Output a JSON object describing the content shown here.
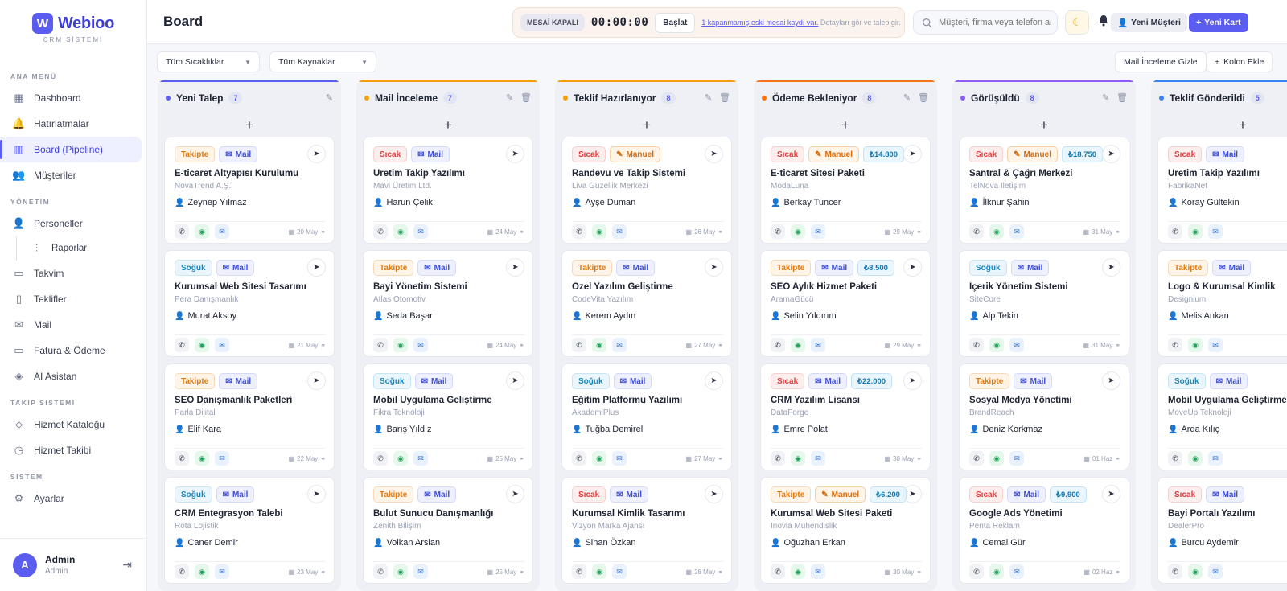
{
  "brand": {
    "name": "Webioo",
    "logo_letter": "W",
    "subtitle": "CRM SİSTEMİ"
  },
  "sidebar": {
    "sections": [
      {
        "title": "ANA MENÜ",
        "items": [
          {
            "label": "Dashboard",
            "icon": "grid-icon"
          },
          {
            "label": "Hatırlatmalar",
            "icon": "bell-icon"
          },
          {
            "label": "Board (Pipeline)",
            "icon": "board-icon",
            "active": true
          },
          {
            "label": "Müşteriler",
            "icon": "users-icon"
          }
        ]
      },
      {
        "title": "YÖNETİM",
        "items": [
          {
            "label": "Personeller",
            "icon": "people-icon"
          },
          {
            "label": "Raporlar",
            "icon": "chart-icon",
            "sub": true
          },
          {
            "label": "Takvim",
            "icon": "calendar-icon"
          },
          {
            "label": "Teklifler",
            "icon": "document-icon"
          },
          {
            "label": "Mail",
            "icon": "mail-icon"
          },
          {
            "label": "Fatura & Ödeme",
            "icon": "card-icon"
          },
          {
            "label": "AI Asistan",
            "icon": "ai-icon"
          }
        ]
      },
      {
        "title": "TAKİP SİSTEMİ",
        "items": [
          {
            "label": "Hizmet Kataloğu",
            "icon": "tag-icon"
          },
          {
            "label": "Hizmet Takibi",
            "icon": "clock-icon"
          }
        ]
      },
      {
        "title": "SİSTEM",
        "items": [
          {
            "label": "Ayarlar",
            "icon": "gear-icon"
          }
        ]
      }
    ],
    "user": {
      "initial": "A",
      "name": "Admin",
      "role": "Admin"
    }
  },
  "topbar": {
    "title": "Board",
    "mesai_status": "MESAİ KAPALI",
    "timer": "00:00:00",
    "start_label": "Başlat",
    "notice_link": "1 kapanmamış eski mesai kaydı var.",
    "notice_text": " Detayları gör ve talep gir.",
    "search_placeholder": "Müşteri, firma veya telefon ara",
    "new_customer_label": "Yeni Müşteri",
    "new_card_label": "Yeni Kart"
  },
  "filters": {
    "heat": "Tüm Sıcaklıklar",
    "source": "Tüm Kaynaklar",
    "hide_mail_label": "Mail İnceleme Gizle",
    "add_column_label": "Kolon Ekle"
  },
  "colors": {
    "accent": "#5b5cf0"
  },
  "columns": [
    {
      "title": "Yeni Talep",
      "count": "7",
      "color": "#5b5cf0",
      "delete": false,
      "cards": [
        {
          "tags": [
            {
              "k": "takipte",
              "t": "Takipte"
            },
            {
              "k": "mail",
              "t": "Mail"
            }
          ],
          "title": "E-ticaret Altyapısı Kurulumu",
          "company": "NovaTrend A.Ş.",
          "person": "Zeynep Yılmaz",
          "date": "20 May"
        },
        {
          "tags": [
            {
              "k": "soguk",
              "t": "Soğuk"
            },
            {
              "k": "mail",
              "t": "Mail"
            }
          ],
          "title": "Kurumsal Web Sitesi Tasarımı",
          "company": "Pera Danışmanlık",
          "person": "Murat Aksoy",
          "date": "21 May"
        },
        {
          "tags": [
            {
              "k": "takipte",
              "t": "Takipte"
            },
            {
              "k": "mail",
              "t": "Mail"
            }
          ],
          "title": "SEO Danışmanlık Paketleri",
          "company": "Parla Dijital",
          "person": "Elif Kara",
          "date": "22 May"
        },
        {
          "tags": [
            {
              "k": "soguk",
              "t": "Soğuk"
            },
            {
              "k": "mail",
              "t": "Mail"
            }
          ],
          "title": "CRM Entegrasyon Talebi",
          "company": "Rota Lojistik",
          "person": "Caner Demir",
          "date": "23 May"
        }
      ]
    },
    {
      "title": "Mail İnceleme",
      "count": "7",
      "color": "#f59e0b",
      "delete": true,
      "cards": [
        {
          "tags": [
            {
              "k": "sicak",
              "t": "Sıcak"
            },
            {
              "k": "mail",
              "t": "Mail"
            }
          ],
          "title": "Üretim Takip Yazılımı",
          "company": "Mavi Üretim Ltd.",
          "person": "Harun Çelik",
          "date": "24 May"
        },
        {
          "tags": [
            {
              "k": "takipte",
              "t": "Takipte"
            },
            {
              "k": "mail",
              "t": "Mail"
            }
          ],
          "title": "Bayi Yönetim Sistemi",
          "company": "Atlas Otomotiv",
          "person": "Seda Başar",
          "date": "24 May"
        },
        {
          "tags": [
            {
              "k": "soguk",
              "t": "Soğuk"
            },
            {
              "k": "mail",
              "t": "Mail"
            }
          ],
          "title": "Mobil Uygulama Geliştirme",
          "company": "Fikra Teknoloji",
          "person": "Barış Yıldız",
          "date": "25 May"
        },
        {
          "tags": [
            {
              "k": "takipte",
              "t": "Takipte"
            },
            {
              "k": "mail",
              "t": "Mail"
            }
          ],
          "title": "Bulut Sunucu Danışmanlığı",
          "company": "Zenith Bilişim",
          "person": "Volkan Arslan",
          "date": "25 May"
        }
      ]
    },
    {
      "title": "Teklif Hazırlanıyor",
      "count": "8",
      "color": "#f59e0b",
      "delete": true,
      "cards": [
        {
          "tags": [
            {
              "k": "sicak",
              "t": "Sıcak"
            },
            {
              "k": "manuel",
              "t": "Manuel"
            }
          ],
          "title": "Randevu ve Takip Sistemi",
          "company": "Liva Güzellik Merkezi",
          "person": "Ayşe Duman",
          "date": "26 May"
        },
        {
          "tags": [
            {
              "k": "takipte",
              "t": "Takipte"
            },
            {
              "k": "mail",
              "t": "Mail"
            }
          ],
          "title": "Özel Yazılım Geliştirme",
          "company": "CodeVita Yazılım",
          "person": "Kerem Aydın",
          "date": "27 May"
        },
        {
          "tags": [
            {
              "k": "soguk",
              "t": "Soğuk"
            },
            {
              "k": "mail",
              "t": "Mail"
            }
          ],
          "title": "Eğitim Platformu Yazılımı",
          "company": "AkademiPlus",
          "person": "Tuğba Demirel",
          "date": "27 May"
        },
        {
          "tags": [
            {
              "k": "sicak",
              "t": "Sıcak"
            },
            {
              "k": "mail",
              "t": "Mail"
            }
          ],
          "title": "Kurumsal Kimlik Tasarımı",
          "company": "Vizyon Marka Ajansı",
          "person": "Sinan Özkan",
          "date": "28 May"
        }
      ]
    },
    {
      "title": "Ödeme Bekleniyor",
      "count": "8",
      "color": "#f97316",
      "delete": true,
      "cards": [
        {
          "tags": [
            {
              "k": "sicak",
              "t": "Sıcak"
            },
            {
              "k": "manuel",
              "t": "Manuel"
            },
            {
              "k": "price",
              "t": "₺14.800"
            }
          ],
          "title": "E-ticaret Sitesi Paketi",
          "company": "ModaLuna",
          "person": "Berkay Tuncer",
          "date": "29 May"
        },
        {
          "tags": [
            {
              "k": "takipte",
              "t": "Takipte"
            },
            {
              "k": "mail",
              "t": "Mail"
            },
            {
              "k": "price",
              "t": "₺8.500"
            }
          ],
          "title": "SEO Aylık Hizmet Paketi",
          "company": "AramaGücü",
          "person": "Selin Yıldırım",
          "date": "29 May"
        },
        {
          "tags": [
            {
              "k": "sicak",
              "t": "Sıcak"
            },
            {
              "k": "mail",
              "t": "Mail"
            },
            {
              "k": "price",
              "t": "₺22.000"
            }
          ],
          "title": "CRM Yazılım Lisansı",
          "company": "DataForge",
          "person": "Emre Polat",
          "date": "30 May"
        },
        {
          "tags": [
            {
              "k": "takipte",
              "t": "Takipte"
            },
            {
              "k": "manuel",
              "t": "Manuel"
            },
            {
              "k": "price",
              "t": "₺6.200"
            }
          ],
          "title": "Kurumsal Web Sitesi Paketi",
          "company": "İnovia Mühendislik",
          "person": "Oğuzhan Erkan",
          "date": "30 May"
        }
      ]
    },
    {
      "title": "Görüşüldü",
      "count": "8",
      "color": "#8b5cf6",
      "delete": true,
      "cards": [
        {
          "tags": [
            {
              "k": "sicak",
              "t": "Sıcak"
            },
            {
              "k": "manuel",
              "t": "Manuel"
            },
            {
              "k": "price",
              "t": "₺18.750"
            }
          ],
          "title": "Santral & Çağrı Merkezi",
          "company": "TelNova İletişim",
          "person": "İlknur Şahin",
          "date": "31 May"
        },
        {
          "tags": [
            {
              "k": "soguk",
              "t": "Soğuk"
            },
            {
              "k": "mail",
              "t": "Mail"
            }
          ],
          "title": "İçerik Yönetim Sistemi",
          "company": "SiteCore",
          "person": "Alp Tekin",
          "date": "31 May"
        },
        {
          "tags": [
            {
              "k": "takipte",
              "t": "Takipte"
            },
            {
              "k": "mail",
              "t": "Mail"
            }
          ],
          "title": "Sosyal Medya Yönetimi",
          "company": "BrandReach",
          "person": "Deniz Korkmaz",
          "date": "01 Haz"
        },
        {
          "tags": [
            {
              "k": "sicak",
              "t": "Sıcak"
            },
            {
              "k": "mail",
              "t": "Mail"
            },
            {
              "k": "price",
              "t": "₺9.900"
            }
          ],
          "title": "Google Ads Yönetimi",
          "company": "Penta Reklam",
          "person": "Cemal Gür",
          "date": "02 Haz"
        }
      ]
    },
    {
      "title": "Teklif Gönderildi",
      "count": "5",
      "color": "#3b82f6",
      "delete": true,
      "cards": [
        {
          "tags": [
            {
              "k": "sicak",
              "t": "Sıcak"
            },
            {
              "k": "mail",
              "t": "Mail"
            }
          ],
          "title": "Üretim Takip Yazılımı",
          "company": "FabrikaNet",
          "person": "Koray Gültekin",
          "date": ""
        },
        {
          "tags": [
            {
              "k": "takipte",
              "t": "Takipte"
            },
            {
              "k": "mail",
              "t": "Mail"
            }
          ],
          "title": "Logo & Kurumsal Kimlik",
          "company": "Designium",
          "person": "Melis Ankan",
          "date": ""
        },
        {
          "tags": [
            {
              "k": "soguk",
              "t": "Soğuk"
            },
            {
              "k": "mail",
              "t": "Mail"
            }
          ],
          "title": "Mobil Uygulama Geliştirme",
          "company": "MoveUp Teknoloji",
          "person": "Arda Kılıç",
          "date": ""
        },
        {
          "tags": [
            {
              "k": "sicak",
              "t": "Sıcak"
            },
            {
              "k": "mail",
              "t": "Mail"
            }
          ],
          "title": "Bayi Portalı Yazılımı",
          "company": "DealerPro",
          "person": "Burcu Aydemir",
          "date": ""
        }
      ]
    }
  ]
}
